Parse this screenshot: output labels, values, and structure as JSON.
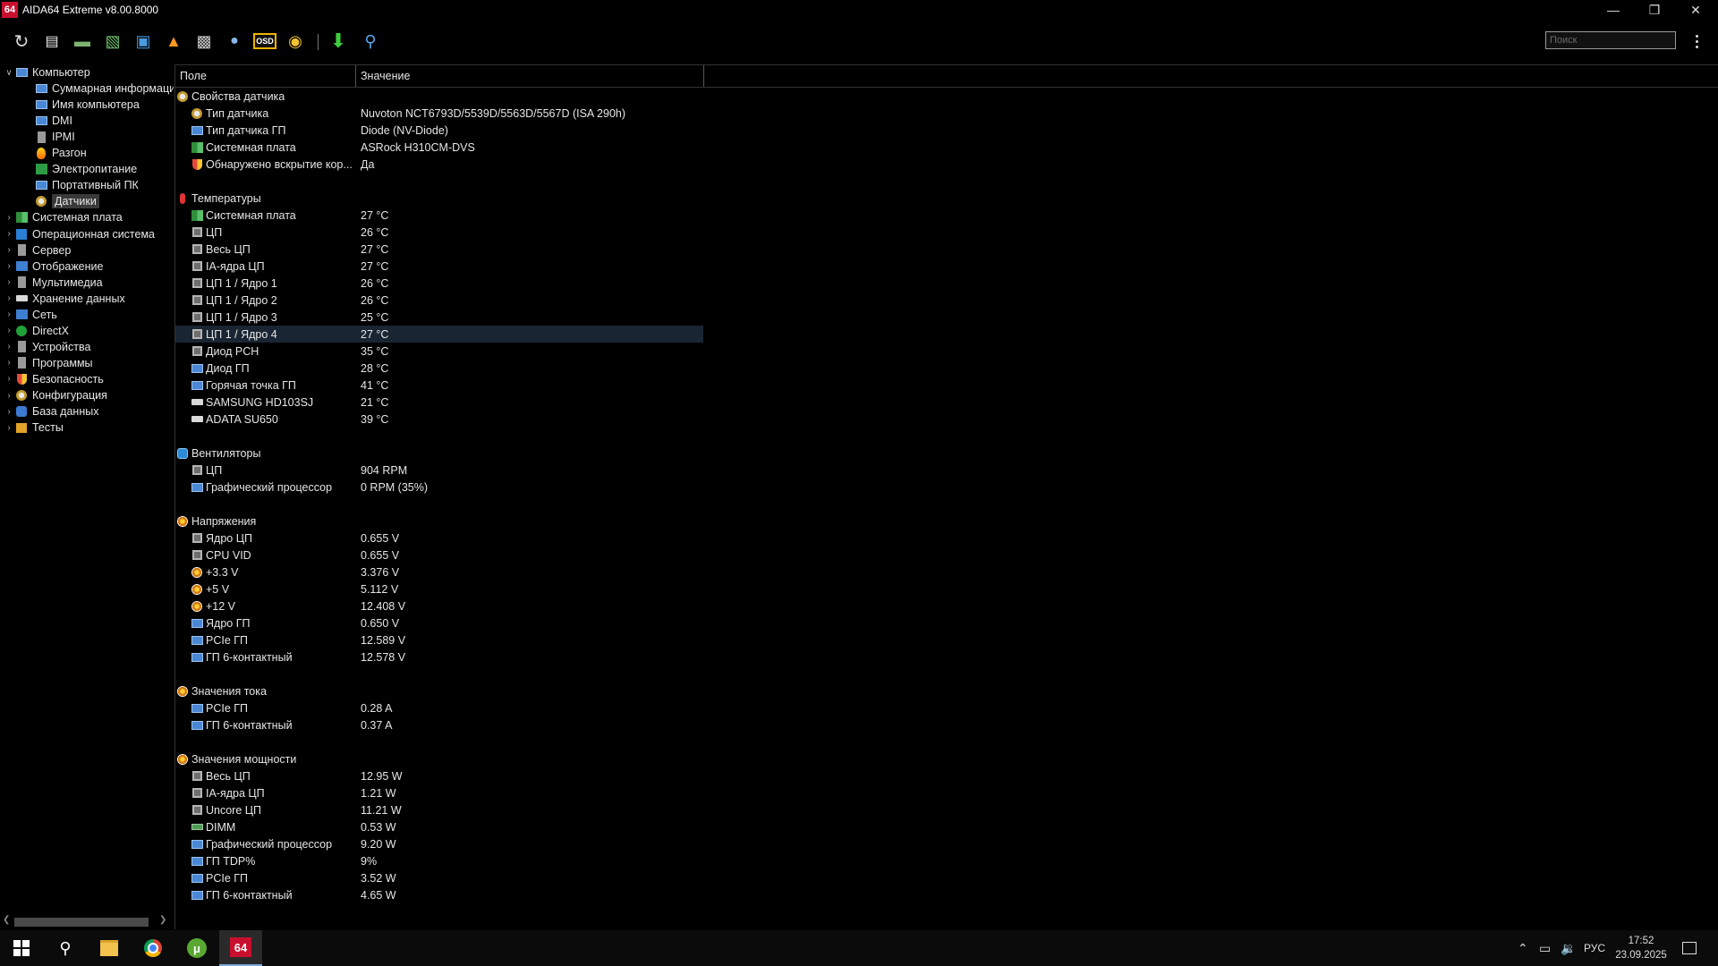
{
  "window": {
    "title": "AIDA64 Extreme v8.00.8000",
    "icon_text": "64"
  },
  "toolbar": {
    "buttons": [
      "refresh-icon",
      "report-icon",
      "motherboard-icon",
      "memory-icon",
      "network-icon",
      "overclock-icon",
      "benchmark-icon",
      "user-icon",
      "osd-icon",
      "sensor-icon",
      "download-icon",
      "search-icon"
    ],
    "osd_label": "OSD",
    "search_placeholder": "Поиск"
  },
  "tree": {
    "root": "Компьютер",
    "children": [
      "Суммарная информация",
      "Имя компьютера",
      "DMI",
      "IPMI",
      "Разгон",
      "Электропитание",
      "Портативный ПК",
      "Датчики"
    ],
    "categories": [
      "Системная плата",
      "Операционная система",
      "Сервер",
      "Отображение",
      "Мультимедиа",
      "Хранение данных",
      "Сеть",
      "DirectX",
      "Устройства",
      "Программы",
      "Безопасность",
      "Конфигурация",
      "База данных",
      "Тесты"
    ],
    "selected": "Датчики"
  },
  "table": {
    "col_field": "Поле",
    "col_value": "Значение",
    "sections": [
      {
        "title": "Свойства датчика",
        "icon": "sensor-icon",
        "rows": [
          {
            "field": "Тип датчика",
            "value": "Nuvoton NCT6793D/5539D/5563D/5567D  (ISA 290h)",
            "icon": "sensor-icon"
          },
          {
            "field": "Тип датчика ГП",
            "value": "Diode  (NV-Diode)",
            "icon": "monitor-icon"
          },
          {
            "field": "Системная плата",
            "value": "ASRock H310CM-DVS",
            "icon": "board-icon"
          },
          {
            "field": "Обнаружено вскрытие кор...",
            "value": "Да",
            "icon": "shield-icon"
          }
        ]
      },
      {
        "title": "Температуры",
        "icon": "thermometer-icon",
        "rows": [
          {
            "field": "Системная плата",
            "value": "27 °C",
            "icon": "board-icon"
          },
          {
            "field": "ЦП",
            "value": "26 °C",
            "icon": "chip-icon"
          },
          {
            "field": "Весь ЦП",
            "value": "27 °C",
            "icon": "chip-icon"
          },
          {
            "field": "IA-ядра ЦП",
            "value": "27 °C",
            "icon": "chip-icon"
          },
          {
            "field": "ЦП 1 / Ядро 1",
            "value": "26 °C",
            "icon": "chip-icon"
          },
          {
            "field": "ЦП 1 / Ядро 2",
            "value": "26 °C",
            "icon": "chip-icon"
          },
          {
            "field": "ЦП 1 / Ядро 3",
            "value": "25 °C",
            "icon": "chip-icon"
          },
          {
            "field": "ЦП 1 / Ядро 4",
            "value": "27 °C",
            "icon": "chip-icon"
          },
          {
            "field": "Диод PCH",
            "value": "35 °C",
            "icon": "chip-icon"
          },
          {
            "field": "Диод ГП",
            "value": "28 °C",
            "icon": "monitor-icon"
          },
          {
            "field": "Горячая точка ГП",
            "value": "41 °C",
            "icon": "monitor-icon"
          },
          {
            "field": "SAMSUNG HD103SJ",
            "value": "21 °C",
            "icon": "disk-icon"
          },
          {
            "field": "ADATA SU650",
            "value": "39 °C",
            "icon": "disk-icon"
          }
        ]
      },
      {
        "title": "Вентиляторы",
        "icon": "fan-icon",
        "rows": [
          {
            "field": "ЦП",
            "value": "904 RPM",
            "icon": "chip-icon"
          },
          {
            "field": "Графический процессор",
            "value": "0 RPM  (35%)",
            "icon": "monitor-icon"
          }
        ]
      },
      {
        "title": "Напряжения",
        "icon": "voltage-icon",
        "rows": [
          {
            "field": "Ядро ЦП",
            "value": "0.655 V",
            "icon": "chip-icon"
          },
          {
            "field": "CPU VID",
            "value": "0.655 V",
            "icon": "chip-icon"
          },
          {
            "field": "+3.3 V",
            "value": "3.376 V",
            "icon": "voltage-icon"
          },
          {
            "field": "+5 V",
            "value": "5.112 V",
            "icon": "voltage-icon"
          },
          {
            "field": "+12 V",
            "value": "12.408 V",
            "icon": "voltage-icon"
          },
          {
            "field": "Ядро ГП",
            "value": "0.650 V",
            "icon": "monitor-icon"
          },
          {
            "field": "PCIe ГП",
            "value": "12.589 V",
            "icon": "monitor-icon"
          },
          {
            "field": "ГП 6-контактный",
            "value": "12.578 V",
            "icon": "monitor-icon"
          }
        ]
      },
      {
        "title": "Значения тока",
        "icon": "voltage-icon",
        "rows": [
          {
            "field": "PCIe ГП",
            "value": "0.28 A",
            "icon": "monitor-icon"
          },
          {
            "field": "ГП 6-контактный",
            "value": "0.37 A",
            "icon": "monitor-icon"
          }
        ]
      },
      {
        "title": "Значения мощности",
        "icon": "voltage-icon",
        "rows": [
          {
            "field": "Весь ЦП",
            "value": "12.95 W",
            "icon": "chip-icon"
          },
          {
            "field": "IA-ядра ЦП",
            "value": "1.21 W",
            "icon": "chip-icon"
          },
          {
            "field": "Uncore ЦП",
            "value": "11.21 W",
            "icon": "chip-icon"
          },
          {
            "field": "DIMM",
            "value": "0.53 W",
            "icon": "memory-icon"
          },
          {
            "field": "Графический процессор",
            "value": "9.20 W",
            "icon": "monitor-icon"
          },
          {
            "field": "ГП TDP%",
            "value": "9%",
            "icon": "monitor-icon"
          },
          {
            "field": "PCIe ГП",
            "value": "3.52 W",
            "icon": "monitor-icon"
          },
          {
            "field": "ГП 6-контактный",
            "value": "4.65 W",
            "icon": "monitor-icon"
          }
        ]
      }
    ],
    "highlighted_row": "ЦП 1 / Ядро 4"
  },
  "taskbar": {
    "apps": [
      "windows-start-icon",
      "search-icon",
      "file-explorer-icon",
      "chrome-icon",
      "utorrent-icon",
      "aida64-icon"
    ],
    "aida_label": "64",
    "language": "РУС",
    "time": "17:52",
    "date": "23.09.2025"
  }
}
